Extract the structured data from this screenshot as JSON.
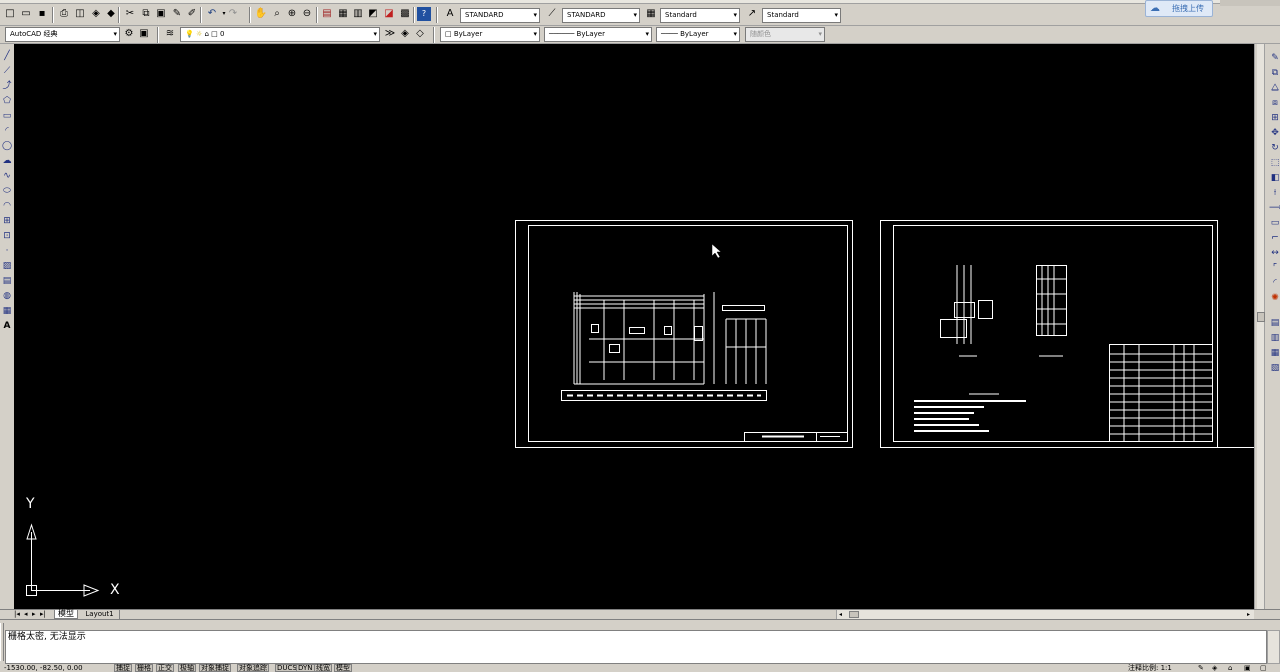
{
  "toolbar1": {
    "text_style": "STANDARD",
    "dim_style": "STANDARD",
    "table_style": "Standard",
    "mleader_style": "Standard"
  },
  "toolbar2": {
    "workspace": "AutoCAD 经典",
    "layer": "0",
    "color": "ByLayer",
    "linetype": "ByLayer",
    "lineweight": "ByLayer",
    "plot_style": "随颜色"
  },
  "upload_button": "拖拽上传",
  "axes": {
    "x": "X",
    "y": "Y"
  },
  "tabs": {
    "model": "模型",
    "layout1": "Layout1"
  },
  "command_line": "栅格太密, 无法显示",
  "status": {
    "coords": "-1530.00, -82.50, 0.00",
    "buttons": [
      "捕捉",
      "栅格",
      "正交",
      "极轴",
      "对象捕捉",
      "对象追踪",
      "DUCS",
      "DYN",
      "线宽",
      "模型"
    ],
    "annotation_scale": "注释比例: 1:1"
  },
  "colors": {
    "canvas": "#000000",
    "chrome": "#d4d0c8",
    "drawing_lines": "#ffffff"
  }
}
